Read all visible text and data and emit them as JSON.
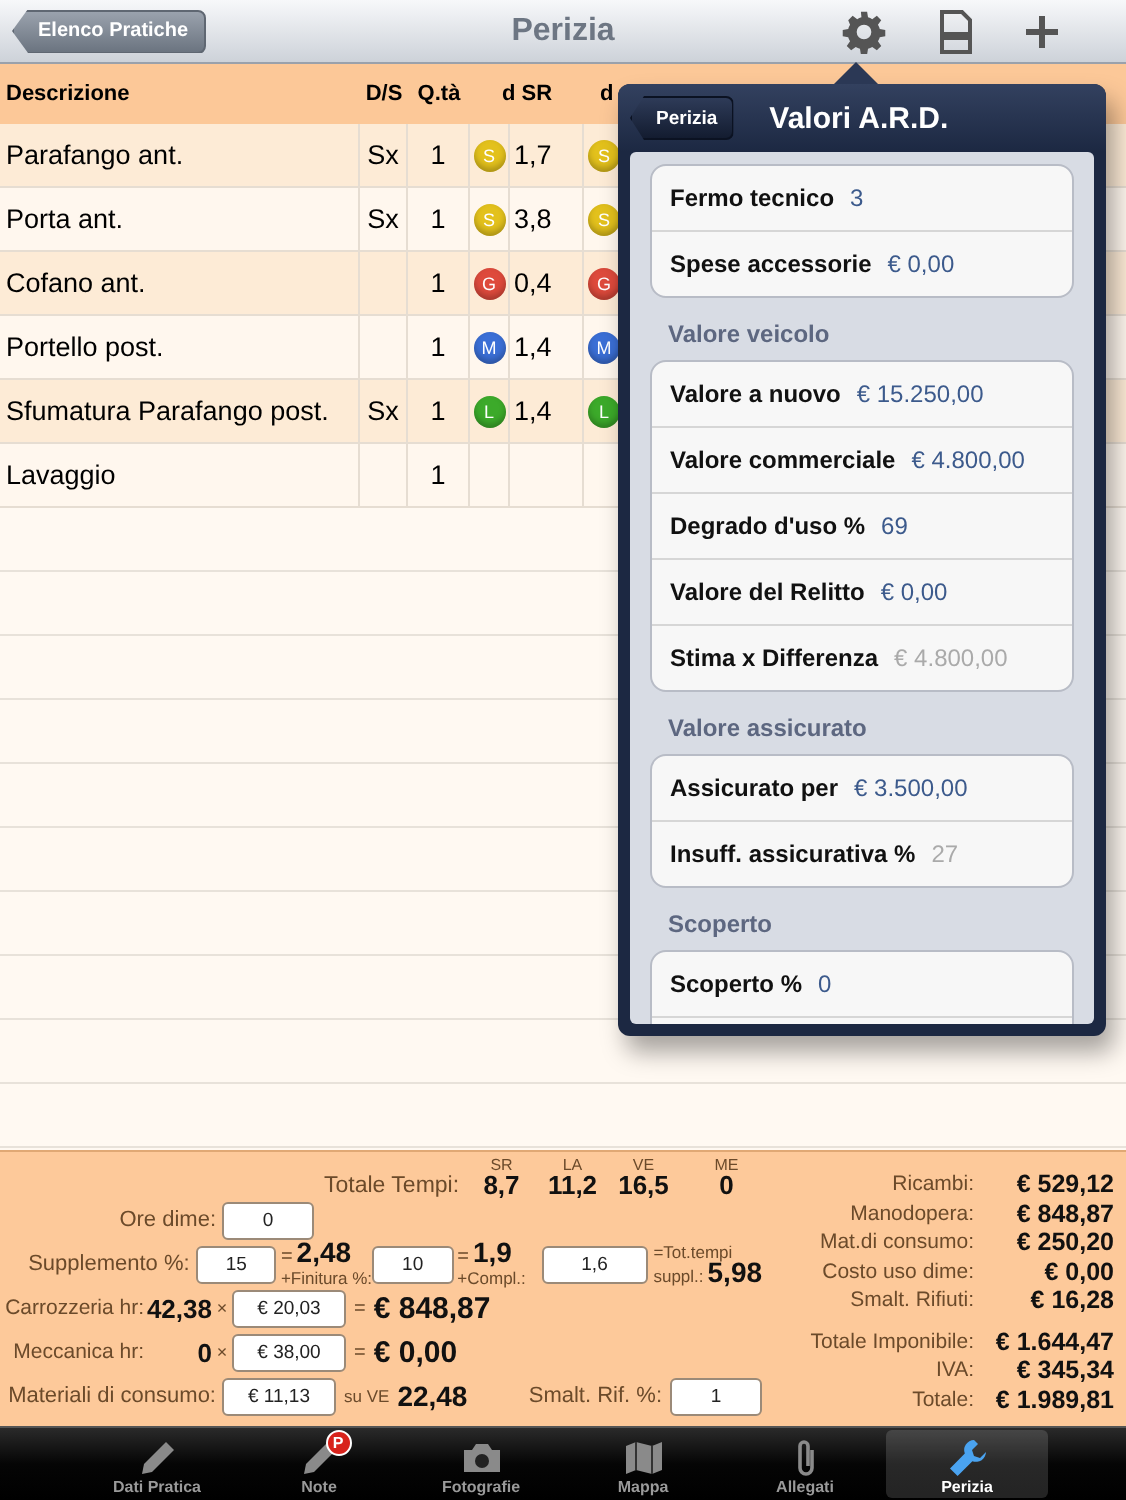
{
  "nav": {
    "back": "Elenco Pratiche",
    "title": "Perizia"
  },
  "table": {
    "columns": [
      "Descrizione",
      "D/S",
      "Q.tà",
      "d SR",
      "d"
    ],
    "rows": [
      {
        "description": "Parafango ant.",
        "side": "Sx",
        "qty": "1",
        "badge": {
          "letter": "S",
          "color": "#e3c11c"
        },
        "sr": "1,7",
        "column_5_badge": {
          "letter": "S",
          "color": "#e3c11c"
        }
      },
      {
        "description": "Porta ant.",
        "side": "Sx",
        "qty": "1",
        "badge": {
          "letter": "S",
          "color": "#e3c11c"
        },
        "sr": "3,8",
        "column_5_badge": {
          "letter": "S",
          "color": "#e3c11c"
        }
      },
      {
        "description": "Cofano ant.",
        "qty": "1",
        "badge": {
          "letter": "G",
          "color": "#de4a3c"
        },
        "sr": "0,4",
        "column_5_badge": {
          "letter": "G",
          "color": "#de4a3c"
        }
      },
      {
        "description": "Portello post.",
        "qty": "1",
        "badge": {
          "letter": "M",
          "color": "#3b6fd6"
        },
        "sr": "1,4",
        "column_5_badge": {
          "letter": "M",
          "color": "#3b6fd6"
        }
      },
      {
        "description": "Sfumatura Parafango post.",
        "side": "Sx",
        "qty": "1",
        "badge": {
          "letter": "L",
          "color": "#3caa2a"
        },
        "sr": "1,4",
        "column_5_badge": {
          "letter": "L",
          "color": "#3caa2a"
        }
      },
      {
        "description": "Lavaggio",
        "qty": "1"
      }
    ]
  },
  "popover": {
    "back": "Perizia",
    "title": "Valori A.R.D.",
    "sections": [
      {
        "rows": [
          {
            "label": "Fermo tecnico",
            "value": "3",
            "muted": false
          },
          {
            "label": "Spese accessorie",
            "value": "€ 0,00",
            "muted": false
          }
        ]
      },
      {
        "header": "Valore veicolo",
        "rows": [
          {
            "label": "Valore a nuovo",
            "value": "€ 15.250,00",
            "muted": false
          },
          {
            "label": "Valore commerciale",
            "value": "€ 4.800,00",
            "muted": false
          },
          {
            "label": "Degrado d'uso %",
            "value": "69",
            "muted": false
          },
          {
            "label": "Valore del Relitto",
            "value": "€ 0,00",
            "muted": false
          },
          {
            "label": "Stima x Differenza",
            "value": "€ 4.800,00",
            "muted": true
          }
        ]
      },
      {
        "header": "Valore assicurato",
        "rows": [
          {
            "label": "Assicurato per",
            "value": "€ 3.500,00",
            "muted": false
          },
          {
            "label": "Insuff. assicurativa %",
            "value": "27",
            "muted": true
          }
        ]
      },
      {
        "header": "Scoperto",
        "rows": [
          {
            "label": "Scoperto %",
            "value": "0",
            "muted": false
          }
        ]
      }
    ]
  },
  "summary": {
    "times": {
      "label": "Totale Tempi:",
      "columns": [
        {
          "code": "SR",
          "value": "8,7"
        },
        {
          "code": "LA",
          "value": "11,2"
        },
        {
          "code": "VE",
          "value": "16,5"
        },
        {
          "code": "ME",
          "value": "0"
        }
      ]
    },
    "die_hours": {
      "label": "Ore dime:",
      "value": "0"
    },
    "supplement": {
      "label": "Supplemento %:",
      "value": "15",
      "eq": "=",
      "result": "2,48",
      "finish_label": "+Finitura %:",
      "finish_value": "10",
      "eq2": "=",
      "finish_result": "1,9",
      "compl_label": "+Compl.:",
      "compl_value": "1,6",
      "total_label": "=Tot.tempi",
      "total_label_2": "suppl.:",
      "total": "5,98"
    },
    "labour": [
      {
        "label": "Carrozzeria hr:",
        "hours": "42,38",
        "times": "×",
        "rate": "€ 20,03",
        "eq": "=",
        "amount": "€ 848,87"
      },
      {
        "label": "Meccanica hr:",
        "hours": "0",
        "times": "×",
        "rate": "€ 38,00",
        "eq": "=",
        "amount": "€ 0,00"
      }
    ],
    "materials": {
      "label": "Materiali di consumo:",
      "value": "€ 11,13",
      "basis_label": "su VE",
      "basis": "22,48"
    },
    "disposal": {
      "label": "Smalt. Rif. %:",
      "value": "1"
    },
    "costs": [
      {
        "label": "Ricambi:",
        "value": "€ 529,12"
      },
      {
        "label": "Manodopera:",
        "value": "€ 848,87"
      },
      {
        "label": "Mat.di consumo:",
        "value": "€ 250,20"
      },
      {
        "label": "Costo uso dime:",
        "value": "€ 0,00"
      },
      {
        "label": "Smalt. Rifiuti:",
        "value": "€ 16,28"
      }
    ],
    "totals": [
      {
        "label": "Totale Imponibile:",
        "value": "€ 1.644,47"
      },
      {
        "label": "IVA:",
        "value": "€ 345,34"
      },
      {
        "label": "Totale:",
        "value": "€ 1.989,81"
      }
    ]
  },
  "tab_bar": [
    {
      "label": "Dati Pratica",
      "selected": false
    },
    {
      "label": "Note",
      "selected": false,
      "badge": "P"
    },
    {
      "label": "Fotografie",
      "selected": false
    },
    {
      "label": "Mappa",
      "selected": false
    },
    {
      "label": "Allegati",
      "selected": false
    },
    {
      "label": "Perizia",
      "selected": true
    }
  ]
}
